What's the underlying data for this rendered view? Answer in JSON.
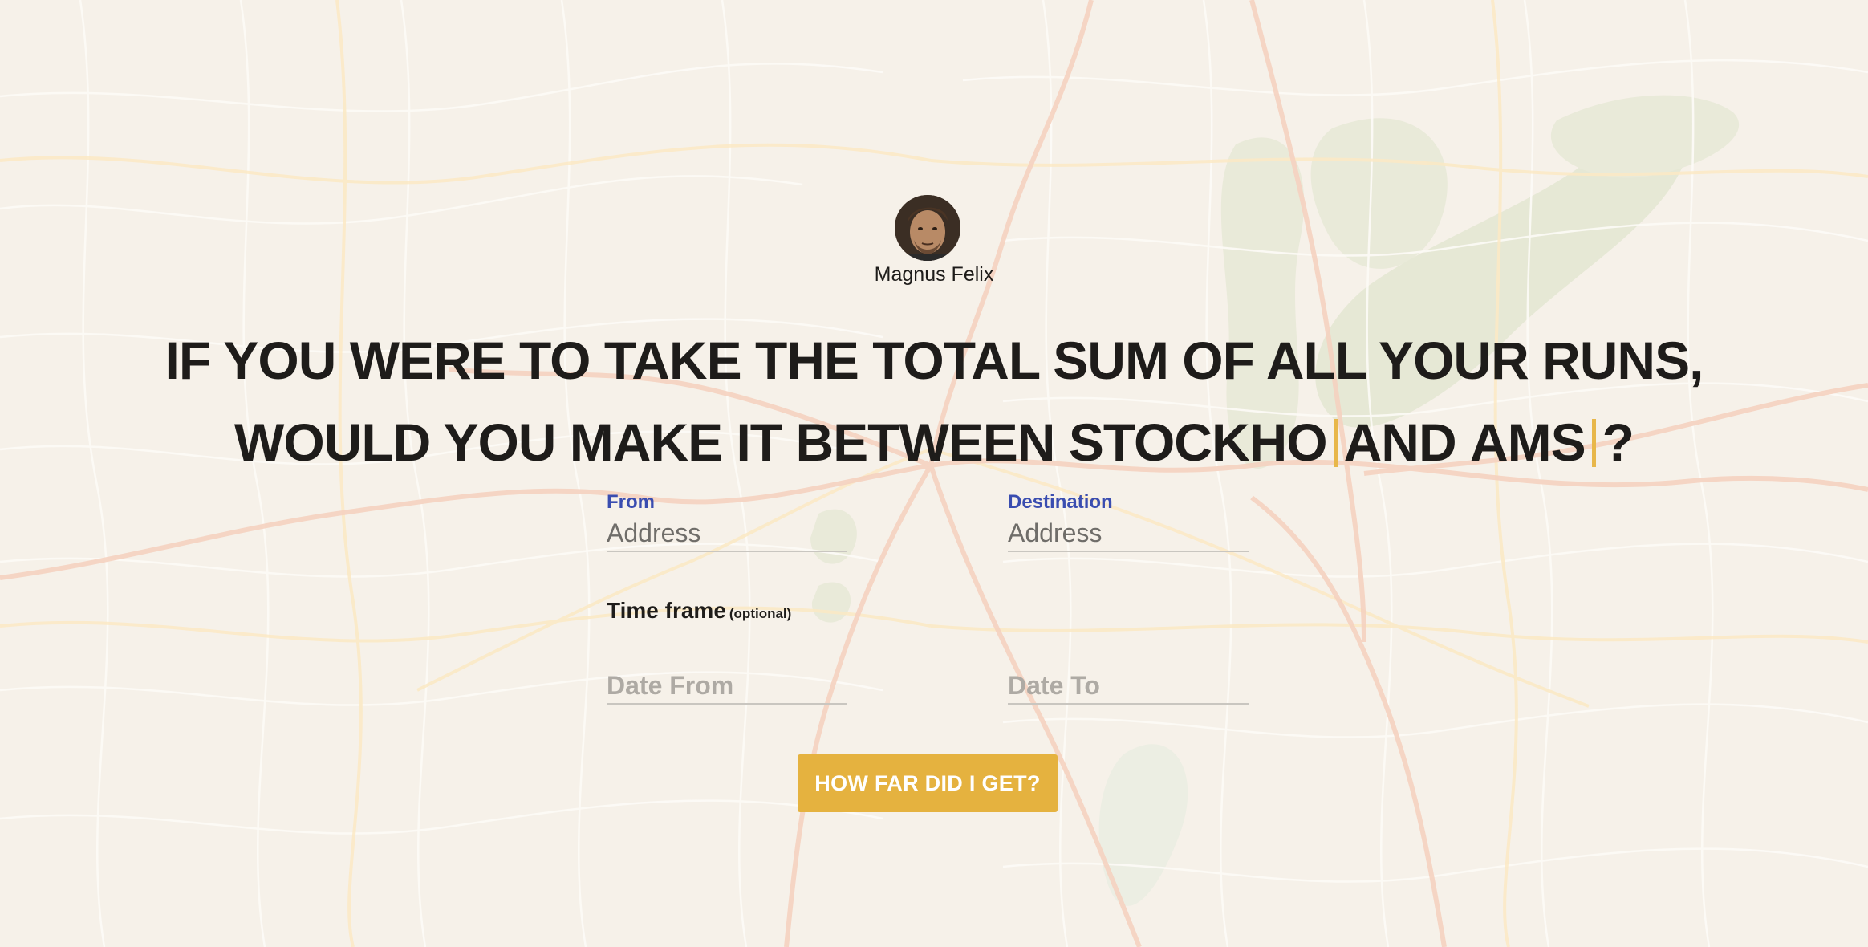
{
  "user": {
    "name": "Magnus Felix"
  },
  "headline": {
    "line1": "IF YOU WERE TO TAKE THE TOTAL SUM OF ALL YOUR RUNS,",
    "line2_prefix": "WOULD YOU MAKE IT BETWEEN",
    "city1_typed": "STOCKHO",
    "connector": "AND",
    "city2_typed": "AMS",
    "suffix": "?"
  },
  "form": {
    "from": {
      "label": "From",
      "placeholder": "Address",
      "value": ""
    },
    "destination": {
      "label": "Destination",
      "placeholder": "Address",
      "value": ""
    },
    "timeframe": {
      "title": "Time frame",
      "optional_note": "(optional)",
      "date_from_placeholder": "Date From",
      "date_to_placeholder": "Date To"
    },
    "submit_label": "HOW FAR DID I GET?"
  },
  "colors": {
    "accent": "#e5b23f",
    "label_blue": "#3a4db0",
    "text": "#1e1c1a",
    "map_background": "#f6f1e9"
  }
}
